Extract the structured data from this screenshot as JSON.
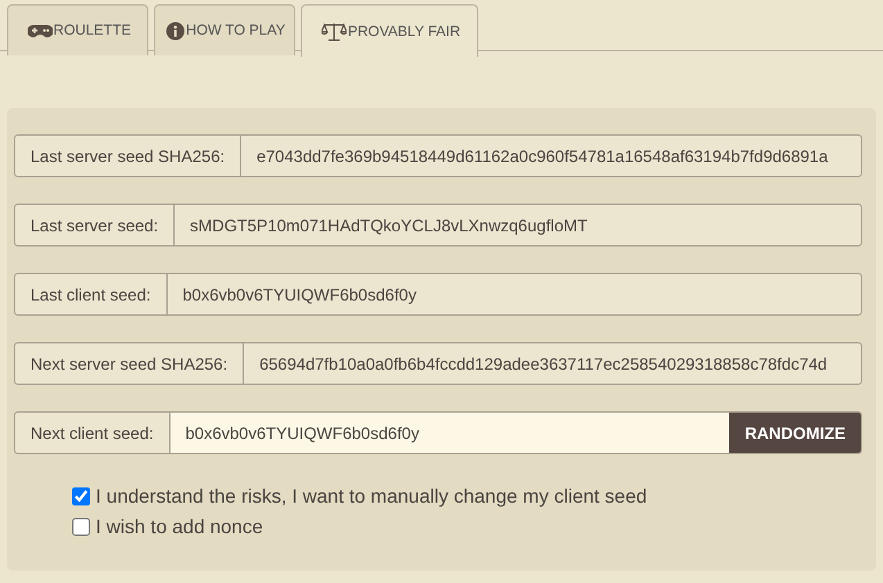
{
  "tabs": [
    {
      "label": "ROULETTE",
      "selected": false
    },
    {
      "label": "HOW TO PLAY",
      "selected": false
    },
    {
      "label": "PROVABLY FAIR",
      "selected": true
    }
  ],
  "seeds": [
    {
      "kind": "readonly",
      "label": "Last server seed SHA256:",
      "value": "e7043dd7fe369b94518449d61162a0c960f54781a16548af63194b7fd9d6891a"
    },
    {
      "kind": "readonly",
      "label": "Last server seed:",
      "value": "sMDGT5P10m071HAdTQkoYCLJ8vLXnwzq6ugfloMT"
    },
    {
      "kind": "readonly",
      "label": "Last client seed:",
      "value": "b0x6vb0v6TYUIQWF6b0sd6f0y"
    },
    {
      "kind": "readonly",
      "label": "Next server seed SHA256:",
      "value": "65694d7fb10a0a0fb6b4fccdd129adee3637117ec25854029318858c78fdc74d"
    },
    {
      "kind": "input",
      "label": "Next client seed:",
      "value": "b0x6vb0v6TYUIQWF6b0sd6f0y",
      "button": "RANDOMIZE"
    }
  ],
  "options": [
    {
      "label": "I understand the risks, I want to manually change my client seed",
      "checked": true
    },
    {
      "label": "I wish to add nonce",
      "checked": false
    }
  ]
}
